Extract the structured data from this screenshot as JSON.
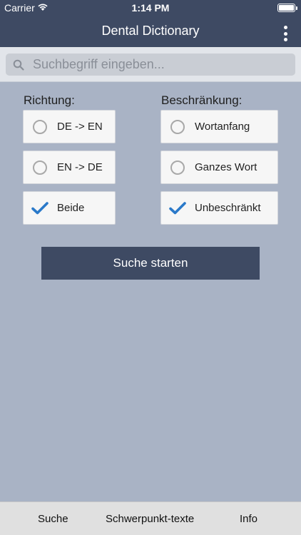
{
  "status_bar": {
    "carrier": "Carrier",
    "time": "1:14 PM",
    "battery_percent": 100
  },
  "header": {
    "title": "Dental Dictionary",
    "menu_icon": "more-vertical-icon"
  },
  "search": {
    "placeholder": "Suchbegriff eingeben...",
    "value": "",
    "icon": "search-icon"
  },
  "direction": {
    "label": "Richtung:",
    "options": [
      {
        "label": "DE -> EN",
        "selected": false
      },
      {
        "label": "EN -> DE",
        "selected": false
      },
      {
        "label": "Beide",
        "selected": true
      }
    ]
  },
  "restriction": {
    "label": "Beschränkung:",
    "options": [
      {
        "label": "Wortanfang",
        "selected": false
      },
      {
        "label": "Ganzes Wort",
        "selected": false
      },
      {
        "label": "Unbeschränkt",
        "selected": true
      }
    ]
  },
  "actions": {
    "start_search_label": "Suche starten"
  },
  "tabs": [
    {
      "label": "Suche"
    },
    {
      "label": "Schwerpunkt-texte"
    },
    {
      "label": "Info"
    }
  ],
  "colors": {
    "nav_background": "#3e4a63",
    "page_background": "#a9b3c5",
    "check_blue": "#2a79c9",
    "tab_background": "#e0e0e0"
  }
}
